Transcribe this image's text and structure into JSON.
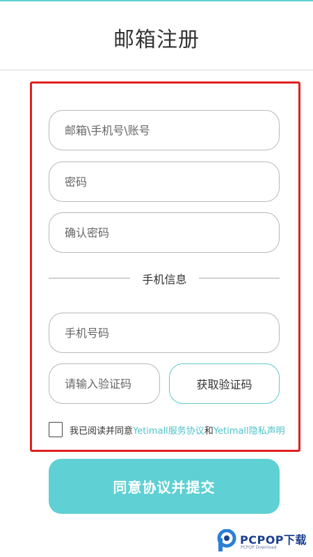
{
  "header": {
    "title": "邮箱注册"
  },
  "form": {
    "account_placeholder": "邮箱\\手机号\\账号",
    "password_placeholder": "密码",
    "confirm_password_placeholder": "确认密码",
    "section_label": "手机信息",
    "phone_placeholder": "手机号码",
    "code_placeholder": "请输入验证码",
    "get_code_label": "获取验证码"
  },
  "agreement": {
    "prefix": "我已阅读并同意",
    "service_link": "Yetimall服务协议",
    "joiner": "和",
    "privacy_link": "Yetimall隐私声明"
  },
  "submit": {
    "label": "同意协议并提交"
  },
  "watermark": {
    "brand": "PCPOP下载",
    "sub": "PCPOP Download"
  },
  "colors": {
    "accent": "#5fd0d4",
    "link": "#4cc3c9",
    "frame": "#e02020"
  }
}
